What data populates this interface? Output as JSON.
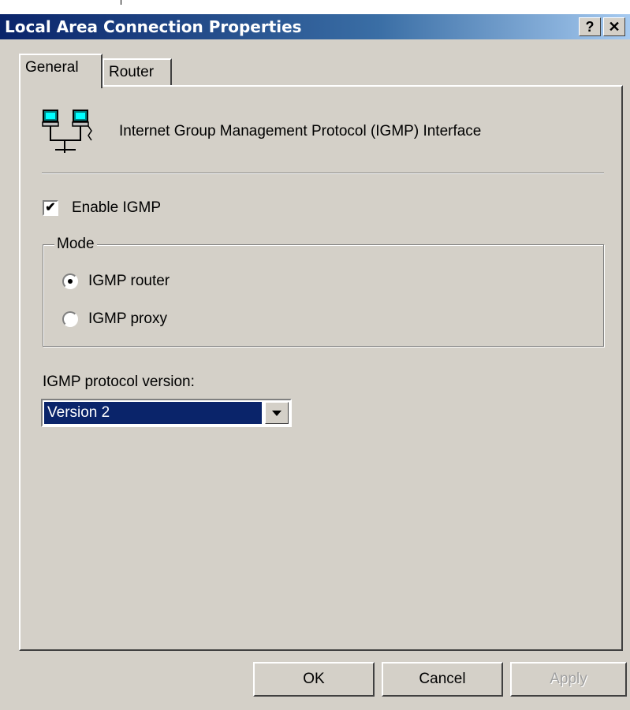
{
  "window": {
    "title": "Local Area Connection Properties",
    "help_label": "?",
    "close_label": "✕"
  },
  "tabs": [
    {
      "label": "General",
      "active": true
    },
    {
      "label": "Router",
      "active": false
    }
  ],
  "general": {
    "icon": "network-computers-icon",
    "heading": "Internet Group Management Protocol (IGMP) Interface",
    "enable_igmp": {
      "label": "Enable IGMP",
      "checked": true,
      "check_glyph": "✔"
    },
    "mode": {
      "legend": "Mode",
      "options": [
        {
          "label": "IGMP router",
          "selected": true
        },
        {
          "label": "IGMP proxy",
          "selected": false
        }
      ]
    },
    "version": {
      "label": "IGMP protocol version:",
      "selected": "Version 2"
    }
  },
  "buttons": {
    "ok": "OK",
    "cancel": "Cancel",
    "apply": "Apply",
    "apply_enabled": false
  },
  "colors": {
    "face": "#d4d0c8",
    "title_start": "#0a246a",
    "title_end": "#a6caf0",
    "selection": "#0a246a"
  }
}
